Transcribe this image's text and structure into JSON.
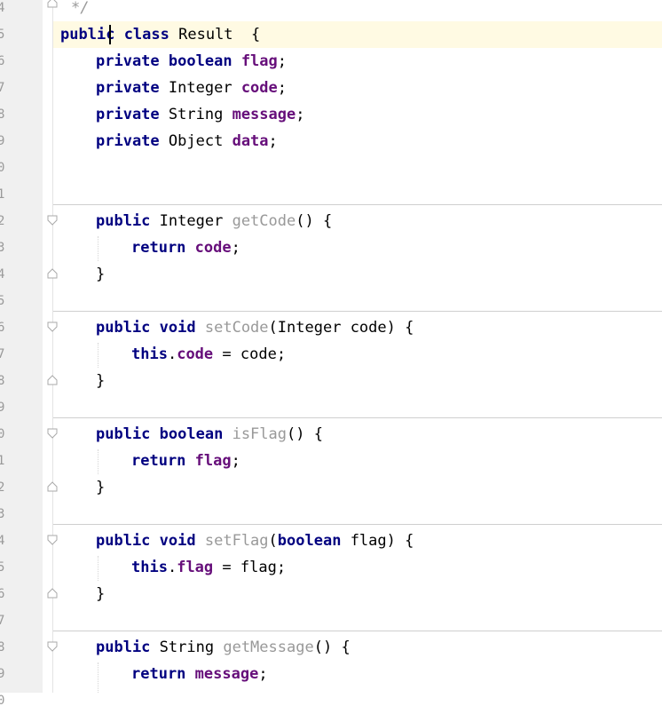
{
  "line_numbers": [
    "4",
    "5",
    "6",
    "7",
    "8",
    "9",
    "0",
    "1",
    "2",
    "3",
    "4",
    "5",
    "6",
    "7",
    "8",
    "9",
    "0",
    "1",
    "2",
    "3",
    "4",
    "5",
    "6",
    "7",
    "8",
    "9",
    "0"
  ],
  "code": {
    "comment_end": "*/",
    "class_decl": {
      "kw_public": "publi",
      "kw_public_tail": "c",
      "kw_class": "class",
      "name": "Result",
      "brace": "{"
    },
    "fields": [
      {
        "kw": "private",
        "type": "boolean",
        "name": "flag"
      },
      {
        "kw": "private",
        "type": "Integer",
        "name": "code"
      },
      {
        "kw": "private",
        "type": "String",
        "name": "message"
      },
      {
        "kw": "private",
        "type": "Object",
        "name": "data"
      }
    ],
    "getCode": {
      "kw": "public",
      "type": "Integer",
      "name": "getCode",
      "params": "()",
      "body_kw": "return",
      "body_field": "code"
    },
    "setCode": {
      "kw": "public",
      "type": "void",
      "name": "setCode",
      "param_type": "Integer",
      "param_name": "code",
      "body_this": "this",
      "body_field": "code",
      "body_rhs": "code"
    },
    "isFlag": {
      "kw": "public",
      "type": "boolean",
      "name": "isFlag",
      "params": "()",
      "body_kw": "return",
      "body_field": "flag"
    },
    "setFlag": {
      "kw": "public",
      "type": "void",
      "name": "setFlag",
      "param_type": "boolean",
      "param_name": "flag",
      "body_this": "this",
      "body_field": "flag",
      "body_rhs": "flag"
    },
    "getMessage": {
      "kw": "public",
      "type": "String",
      "name": "getMessage",
      "params": "()",
      "body_kw": "return",
      "body_field": "message"
    },
    "close_brace": "}",
    "semicolon": ";"
  },
  "colors": {
    "keyword": "#000080",
    "field": "#660e7a",
    "method_decl": "#999999",
    "caret_row": "#fffae3",
    "gutter": "#f0f0f0"
  }
}
